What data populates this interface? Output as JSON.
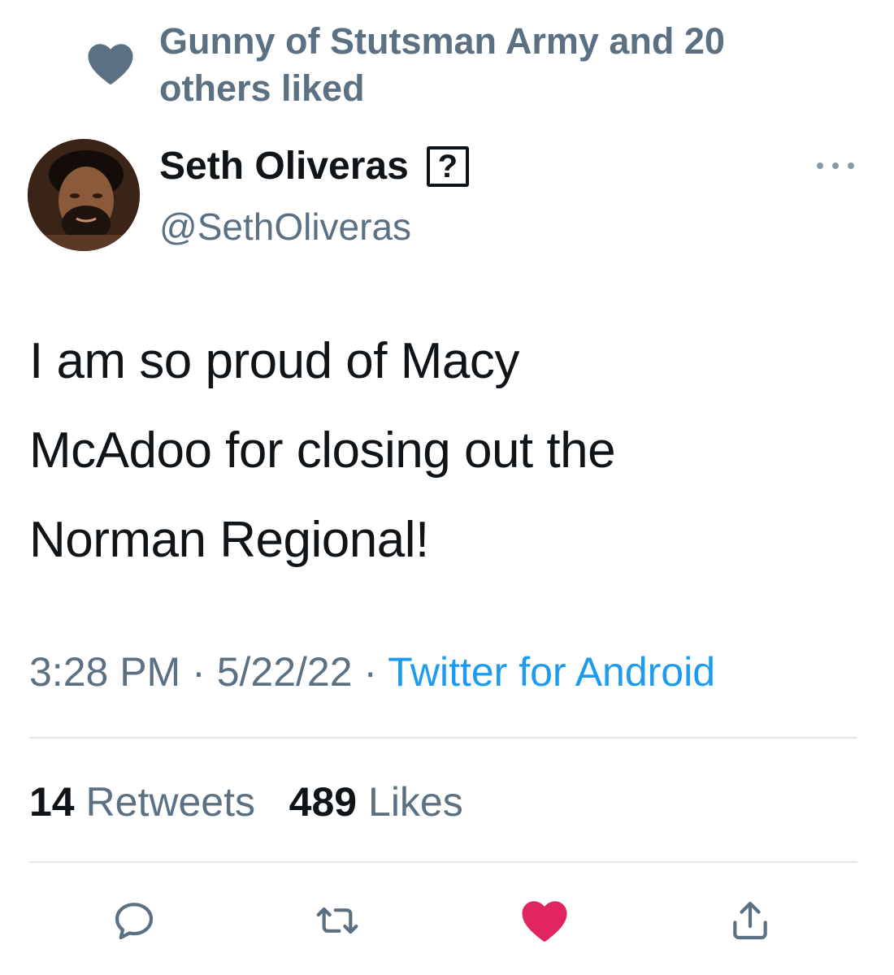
{
  "social_context": {
    "text": "Gunny of Stutsman Army and 20 others liked",
    "icon": "heart-icon",
    "color": "#5b7083"
  },
  "author": {
    "display_name": "Seth Oliveras",
    "name_suffix_glyph": "?",
    "handle": "@SethOliveras"
  },
  "tweet": {
    "lines": [
      "I am so proud of Macy",
      "McAdoo for closing out the",
      "Norman Regional!"
    ]
  },
  "meta": {
    "time": "3:28 PM",
    "separator": "·",
    "date": "5/22/22",
    "source": "Twitter for Android",
    "source_color": "#1d9bf0"
  },
  "stats": {
    "retweets_count": "14",
    "retweets_label": "Retweets",
    "likes_count": "489",
    "likes_label": "Likes"
  },
  "actions": [
    {
      "name": "reply",
      "icon": "comment-icon"
    },
    {
      "name": "retweet",
      "icon": "retweet-icon"
    },
    {
      "name": "like",
      "icon": "heart-filled-icon",
      "color": "#e0245e"
    },
    {
      "name": "share",
      "icon": "share-icon"
    }
  ]
}
